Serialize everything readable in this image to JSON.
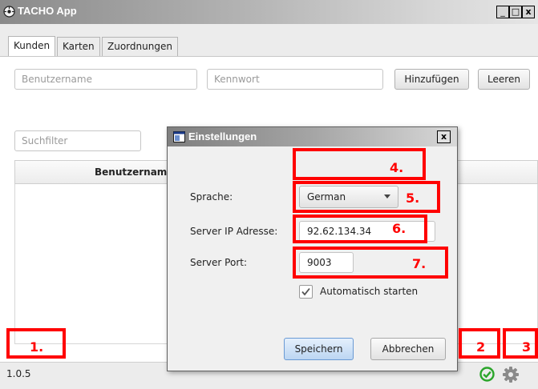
{
  "window": {
    "title": "TACHO App",
    "minimize_glyph": "_",
    "maximize_glyph": "□",
    "close_glyph": "x"
  },
  "tabs": [
    {
      "label": "Kunden",
      "active": true
    },
    {
      "label": "Karten",
      "active": false
    },
    {
      "label": "Zuordnungen",
      "active": false
    }
  ],
  "form": {
    "username_placeholder": "Benutzername",
    "password_placeholder": "Kennwort",
    "add_label": "Hinzufügen",
    "clear_label": "Leeren",
    "search_placeholder": "Suchfilter"
  },
  "table": {
    "columns": [
      "Benutzernam"
    ]
  },
  "statusbar": {
    "version": "1.0.5",
    "status_icon": "check-circle-icon",
    "settings_icon": "gear-icon",
    "status_color": "#2aa52a"
  },
  "dialog": {
    "title": "Einstellungen",
    "close_glyph": "x",
    "language_label": "Sprache:",
    "language_value": "German",
    "server_ip_label": "Server IP Adresse:",
    "server_ip_value": "92.62.134.34",
    "server_port_label": "Server Port:",
    "server_port_value": "9003",
    "autostart_label": "Automatisch starten",
    "autostart_checked": true,
    "save_label": "Speichern",
    "cancel_label": "Abbrechen"
  },
  "annotations": {
    "color": "#ff0000",
    "labels": [
      "1.",
      "2",
      "3",
      "4.",
      "5.",
      "6.",
      "7."
    ]
  }
}
